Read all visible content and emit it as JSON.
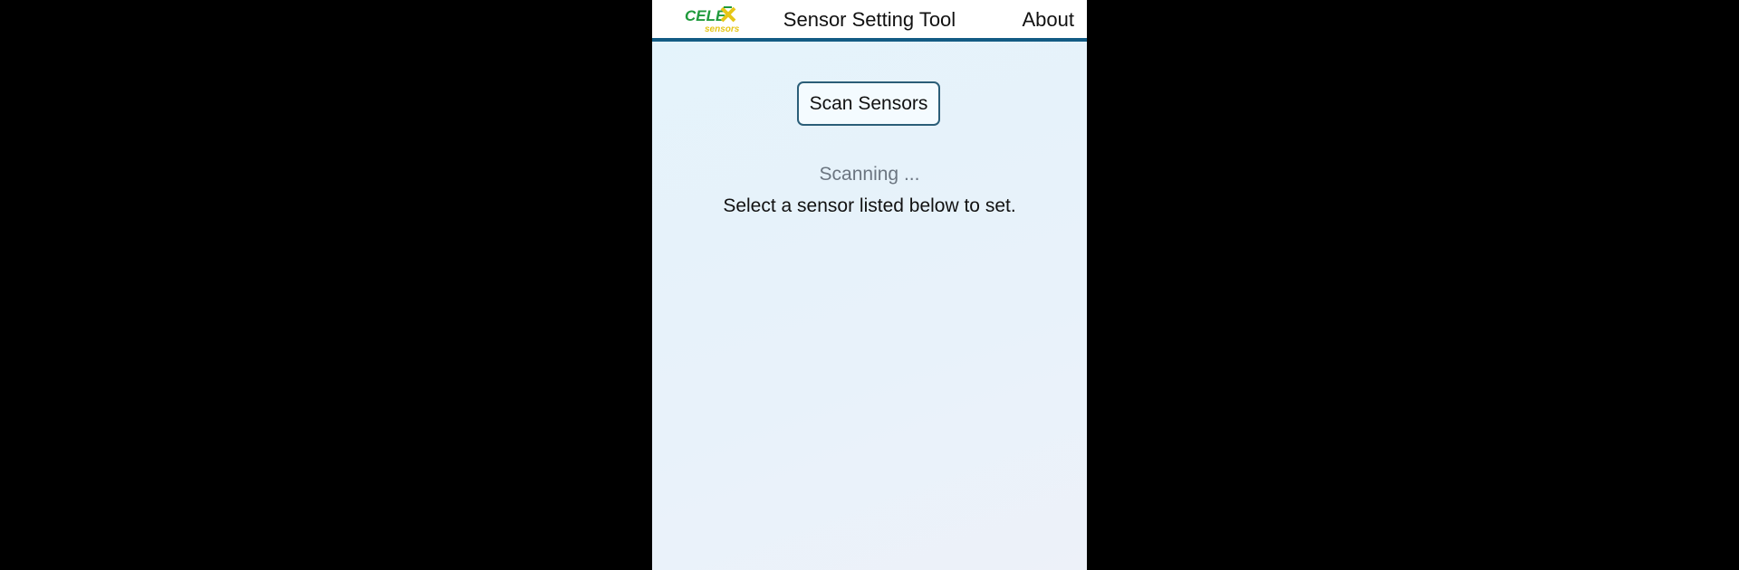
{
  "header": {
    "logo_text": "CELEX SENSORS",
    "title": "Sensor Setting Tool",
    "about_label": "About"
  },
  "main": {
    "scan_button_label": "Scan Sensors",
    "status_text": "Scanning ...",
    "instruction_text": "Select a sensor listed below to set.",
    "sensors": []
  },
  "colors": {
    "header_rule": "#135b84",
    "logo_green": "#1f9a3c",
    "logo_yellow": "#e6c617",
    "background": "#e6f3fb",
    "status_gray": "#6b7580"
  }
}
